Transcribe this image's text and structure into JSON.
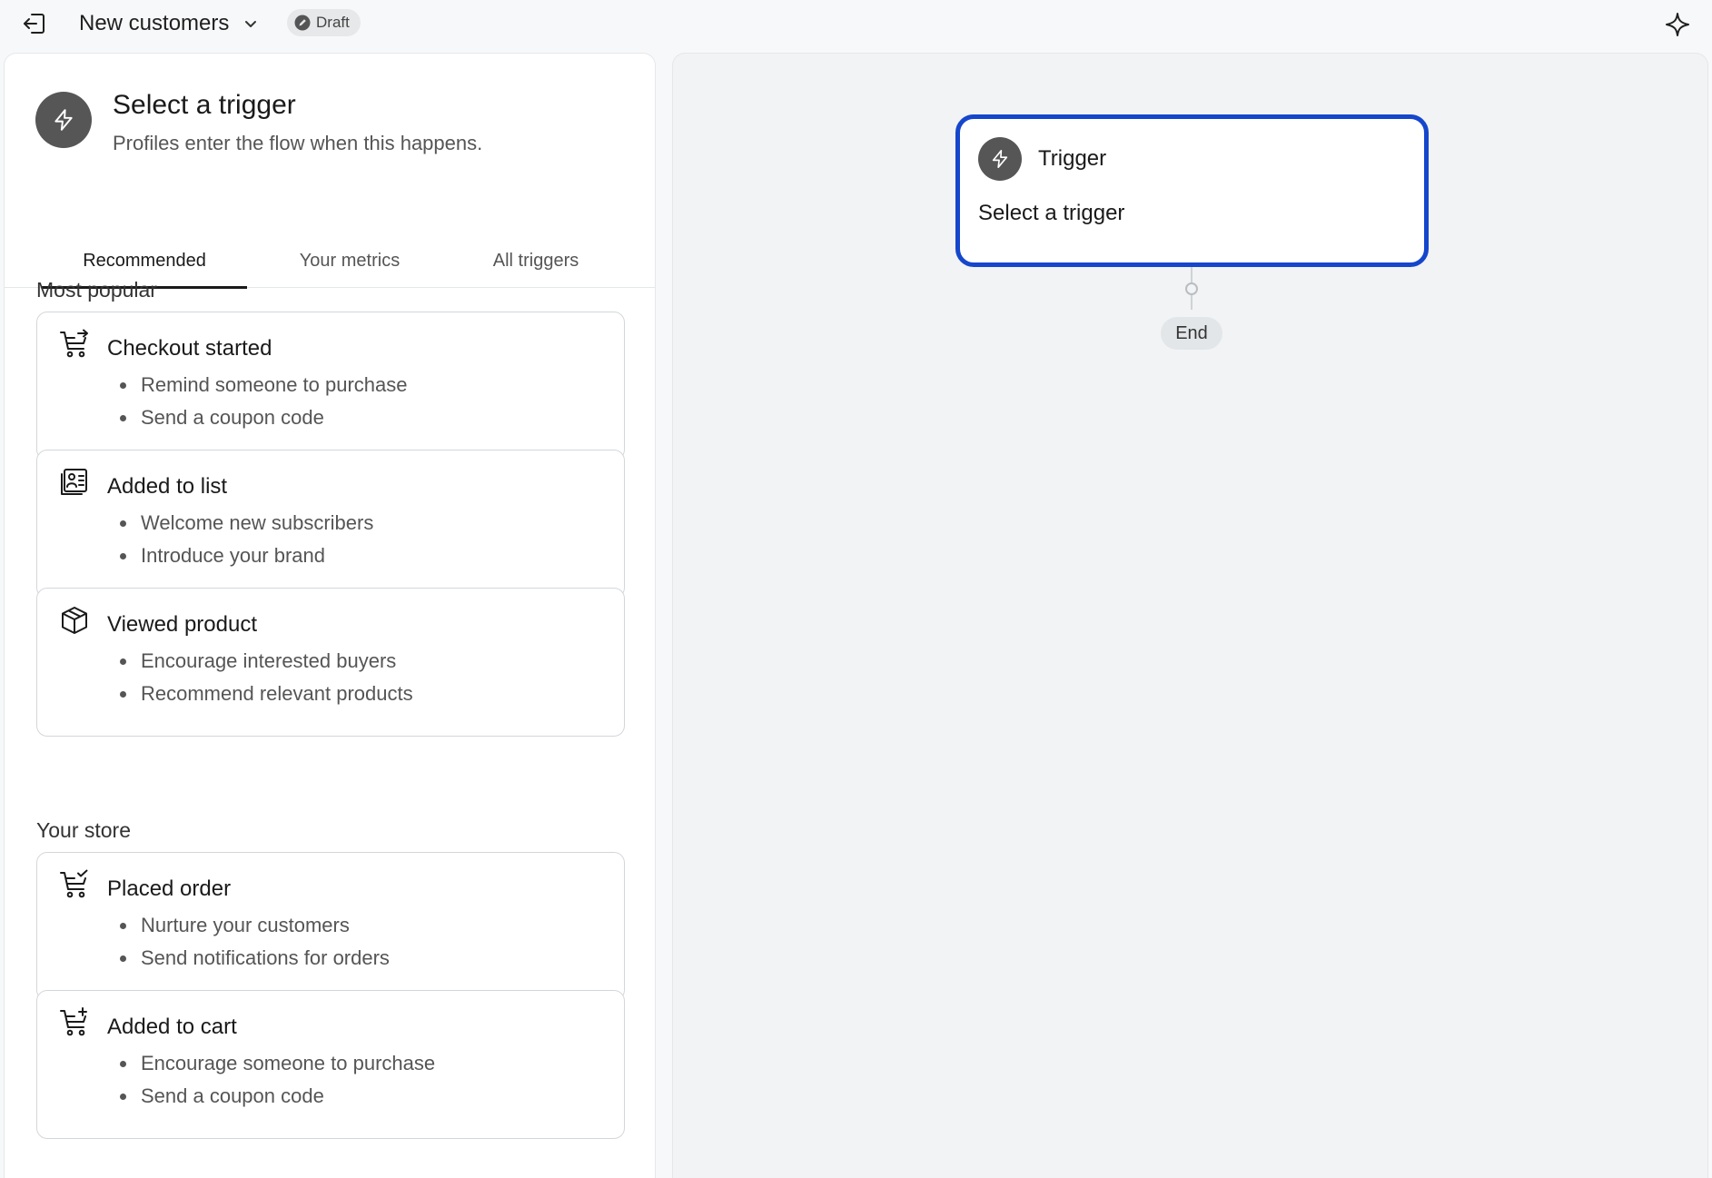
{
  "topbar": {
    "flow_name": "New customers",
    "status": "Draft",
    "icons": {
      "exit": "exit-icon",
      "dropdown": "chevron-down-icon",
      "status": "edit-icon",
      "ai": "sparkle-icon"
    }
  },
  "panel": {
    "title": "Select a trigger",
    "subtitle": "Profiles enter the flow when this happens.",
    "tabs": [
      {
        "label": "Recommended",
        "active": true
      },
      {
        "label": "Your metrics",
        "active": false
      },
      {
        "label": "All triggers",
        "active": false
      }
    ],
    "sections": [
      {
        "label": "Most popular",
        "cards": [
          {
            "icon": "cart-arrow-icon",
            "title": "Checkout started",
            "bullets": [
              "Remind someone to purchase",
              "Send a coupon code"
            ]
          },
          {
            "icon": "contact-list-icon",
            "title": "Added to list",
            "bullets": [
              "Welcome new subscribers",
              "Introduce your brand"
            ]
          },
          {
            "icon": "package-icon",
            "title": "Viewed product",
            "bullets": [
              "Encourage interested buyers",
              "Recommend relevant products"
            ]
          }
        ]
      },
      {
        "label": "Your store",
        "cards": [
          {
            "icon": "cart-check-icon",
            "title": "Placed order",
            "bullets": [
              "Nurture your customers",
              "Send notifications for orders"
            ]
          },
          {
            "icon": "cart-plus-icon",
            "title": "Added to cart",
            "bullets": [
              "Encourage someone to purchase",
              "Send a coupon code"
            ]
          }
        ]
      }
    ]
  },
  "canvas": {
    "node": {
      "title": "Trigger",
      "subtitle": "Select a trigger",
      "icon": "lightning-icon"
    },
    "end_label": "End"
  },
  "colors": {
    "accent": "#1546cc",
    "icon_bg": "#565656",
    "canvas_bg": "#f1f3f4"
  }
}
